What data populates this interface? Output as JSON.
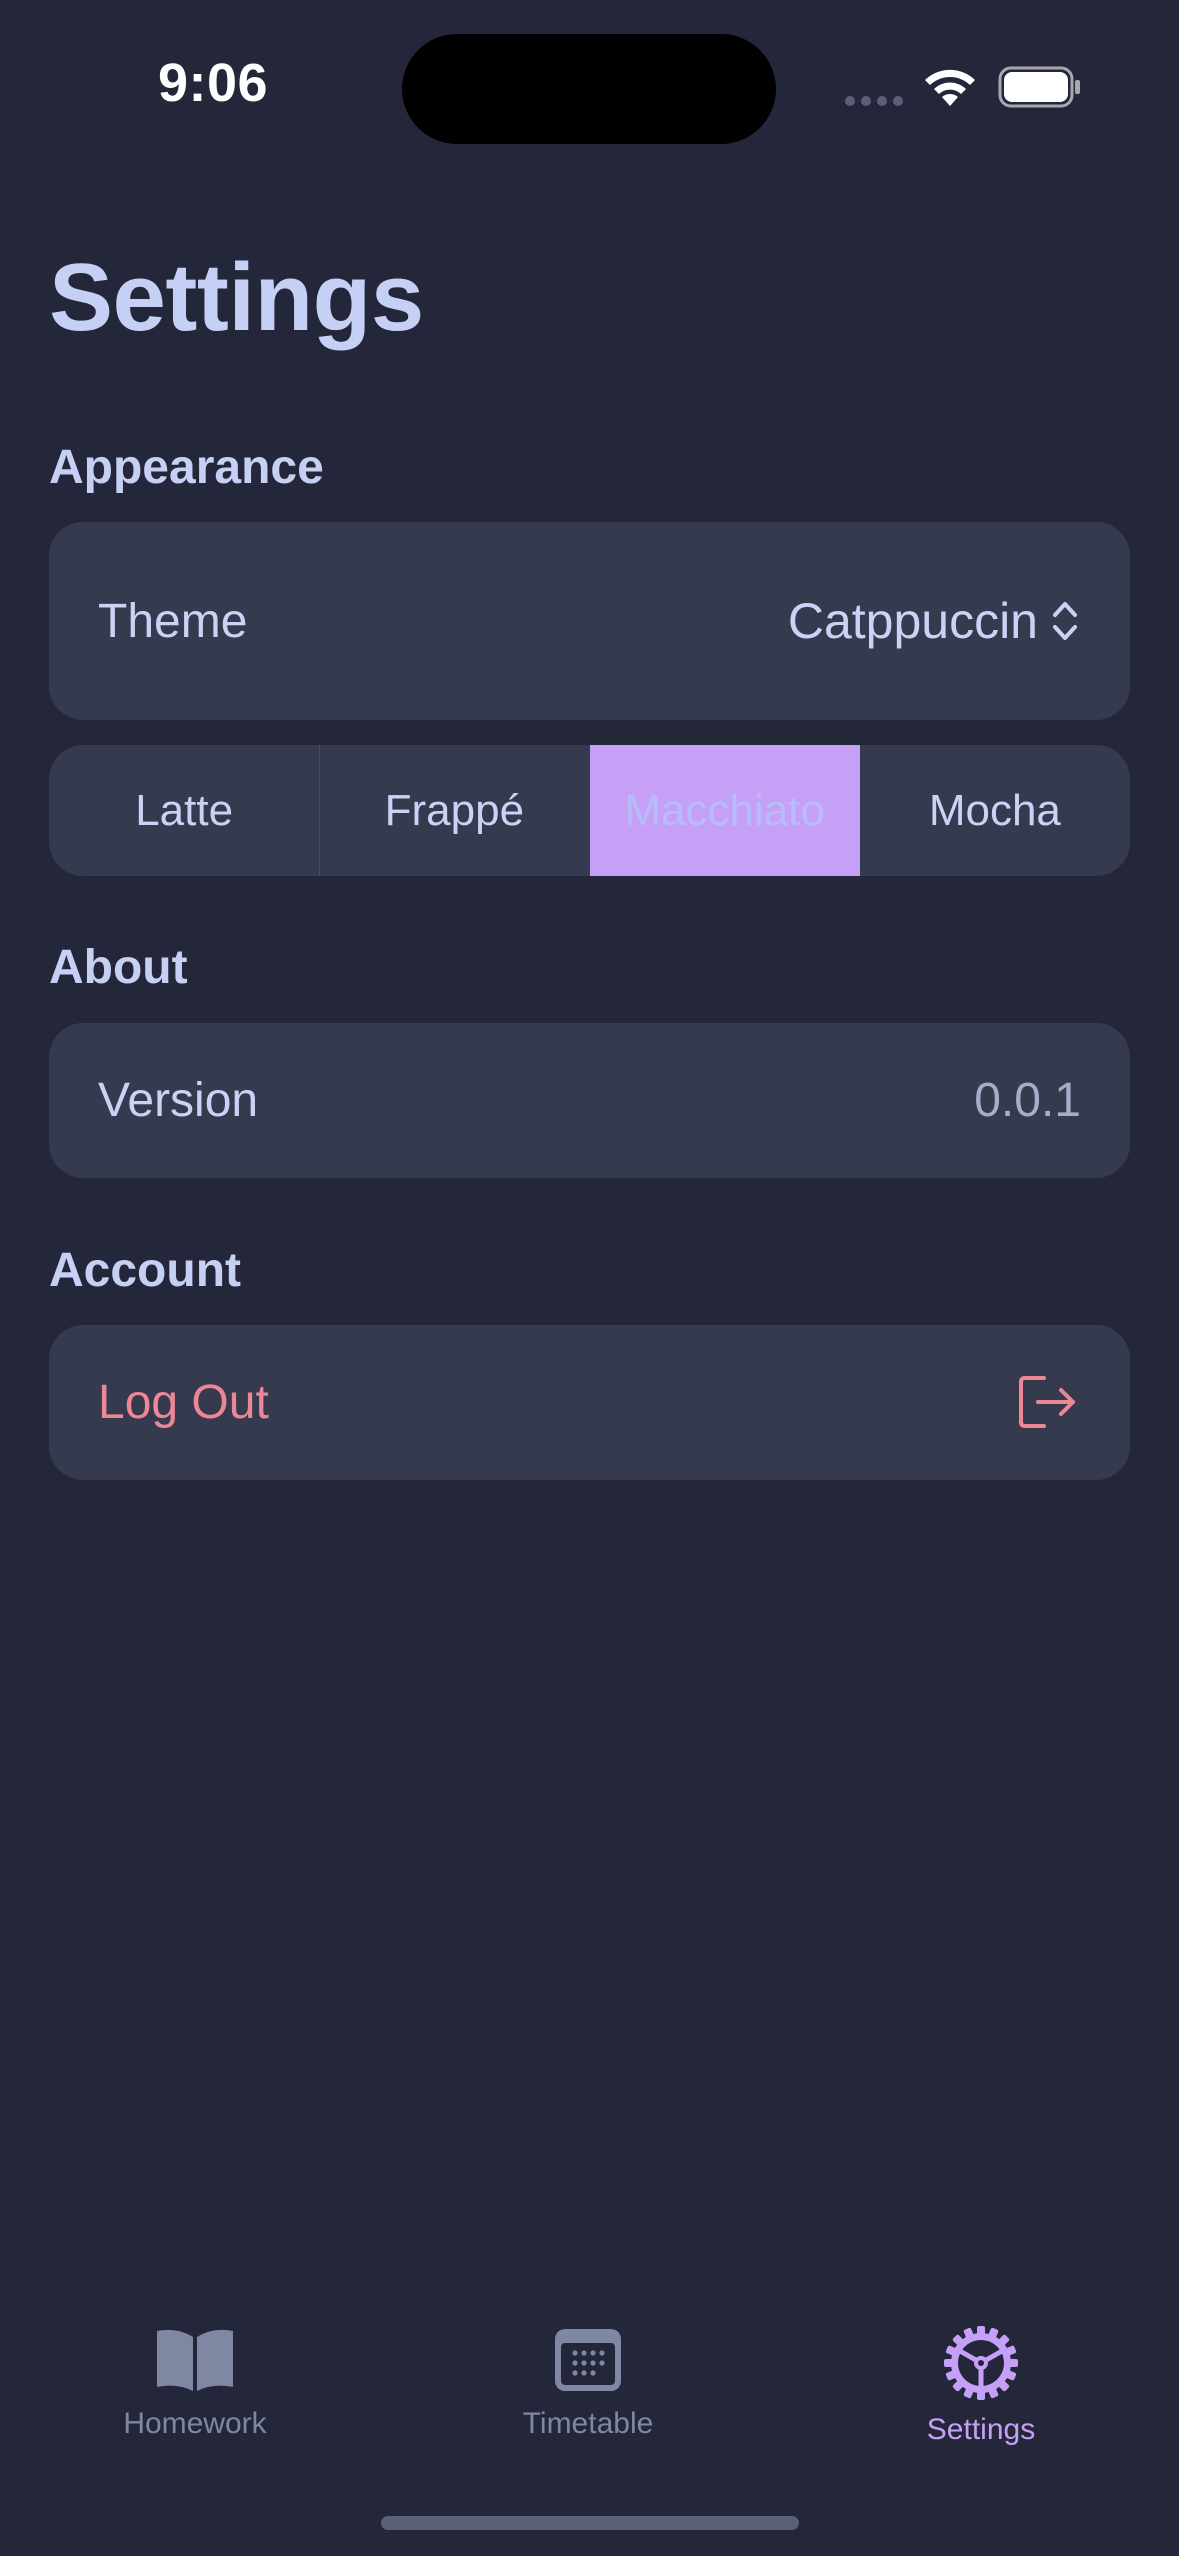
{
  "status_bar": {
    "time": "9:06"
  },
  "title": "Settings",
  "appearance": {
    "header": "Appearance",
    "theme_label": "Theme",
    "theme_value": "Catppuccin",
    "flavors": [
      "Latte",
      "Frappé",
      "Macchiato",
      "Mocha"
    ],
    "selected_flavor": "Macchiato"
  },
  "about": {
    "header": "About",
    "version_label": "Version",
    "version_value": "0.0.1"
  },
  "account": {
    "header": "Account",
    "logout_label": "Log Out"
  },
  "tabs": [
    {
      "label": "Homework",
      "icon": "book-icon"
    },
    {
      "label": "Timetable",
      "icon": "calendar-icon"
    },
    {
      "label": "Settings",
      "icon": "gear-icon"
    }
  ],
  "active_tab": "Settings",
  "colors": {
    "background": "#24273a",
    "card": "#363a4f",
    "text": "#cad3f5",
    "accent": "#c6a0f6",
    "destructive": "#ed8796",
    "inactive_tab": "#8087a2"
  }
}
